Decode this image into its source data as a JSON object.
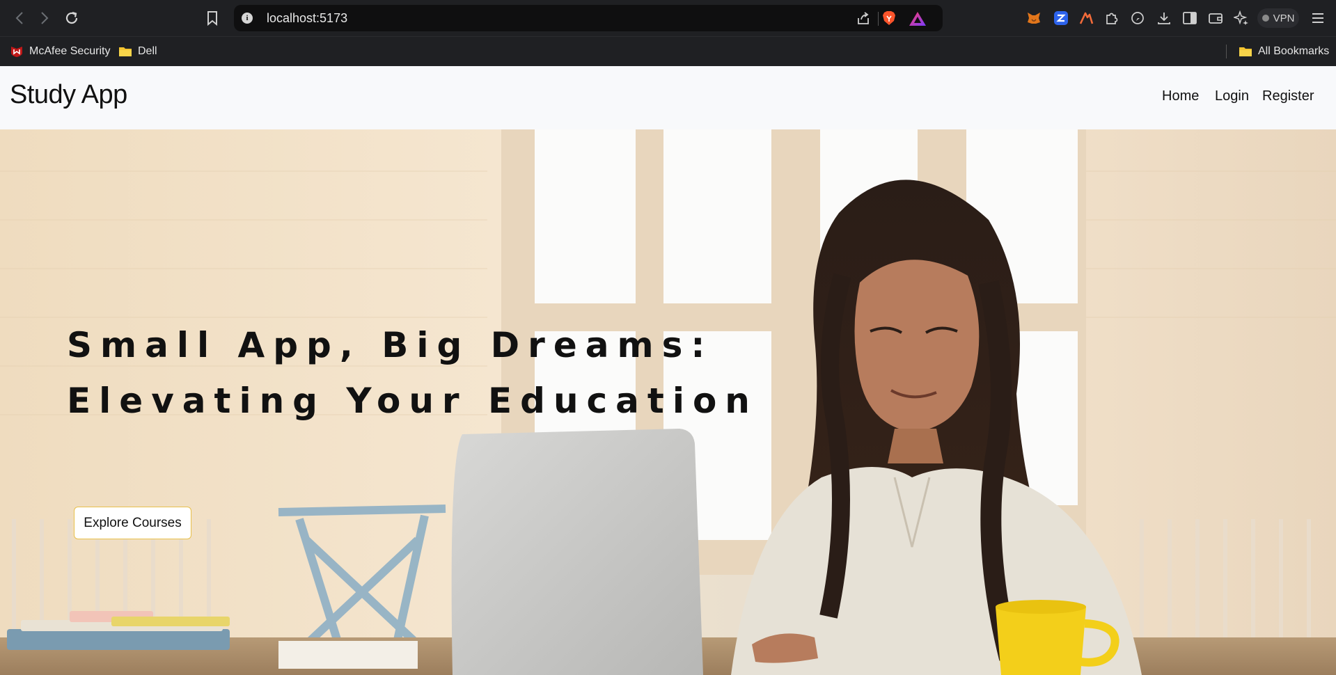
{
  "browser": {
    "url": "localhost:5173",
    "vpn_label": "VPN",
    "bookmarks": [
      {
        "label": "McAfee Security"
      },
      {
        "label": "Dell"
      }
    ],
    "all_bookmarks_label": "All Bookmarks"
  },
  "navbar": {
    "brand": "Study App",
    "links": [
      "Home",
      "Login",
      "Register"
    ]
  },
  "hero": {
    "title_line1": "Small App, Big Dreams:",
    "title_line2": "Elevating Your Education",
    "cta_label": "Explore Courses"
  },
  "colors": {
    "chrome_bg": "#1f2023",
    "address_bg": "#0f0f10",
    "navbar_bg": "#f8f9fb",
    "cta_border": "#e8c04a"
  }
}
